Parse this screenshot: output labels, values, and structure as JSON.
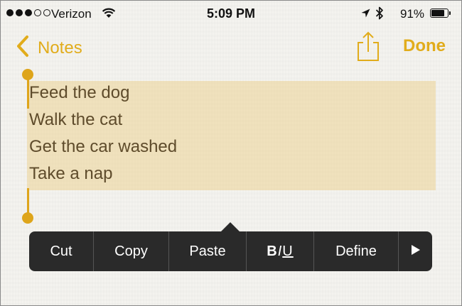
{
  "status_bar": {
    "carrier": "Verizon",
    "time": "5:09 PM",
    "battery_percent": "91%",
    "battery_level": 0.91,
    "signal_bars_filled": 3,
    "signal_bars_total": 5
  },
  "nav": {
    "back_label": "Notes",
    "done_label": "Done",
    "accent_color": "#e1ac1b"
  },
  "note": {
    "lines": [
      "Feed the dog",
      "Walk the cat",
      "Get the car washed",
      "Take a nap"
    ],
    "selection_color": "#ecd080"
  },
  "edit_menu": {
    "items": [
      "Cut",
      "Copy",
      "Paste",
      "BIU",
      "Define"
    ],
    "more_icon": "play-triangle-icon",
    "format": {
      "bold": "B",
      "italic": "I",
      "underline": "U"
    }
  }
}
